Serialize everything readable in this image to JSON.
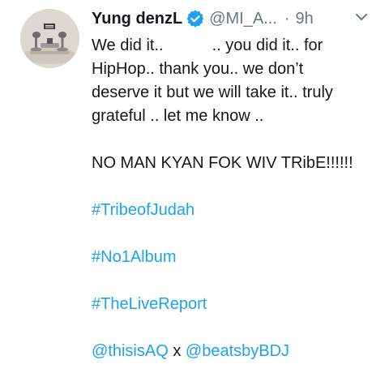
{
  "tweet": {
    "display_name": "Yung denzL",
    "handle": "@MI_A...",
    "separator": "·",
    "time": "9h",
    "icons": {
      "verified": "verified-badge-icon",
      "menu": "chevron-down-icon"
    },
    "colors": {
      "link": "#1da1f2",
      "verified": "#1da1f2",
      "muted": "#657786",
      "text": "#14171a"
    },
    "lines": {
      "l1a": "We did it..",
      "l1b": ".. you did it.. for",
      "l2": "HipHop.. thank you.. we don’t",
      "l3": "deserve it but we will take it.. truly",
      "l4": "grateful .. let me know ..",
      "l5": "NO MAN KYAN FOK WIV TRibE!!!!!!"
    },
    "hashtags": {
      "h1": "#TribeofJudah",
      "h2": "#No1Album",
      "h3": "#TheLiveReport"
    },
    "mentions": {
      "m1": "@thisisAQ",
      "joiner": " x ",
      "m2": "@beatsbyBDJ"
    }
  }
}
